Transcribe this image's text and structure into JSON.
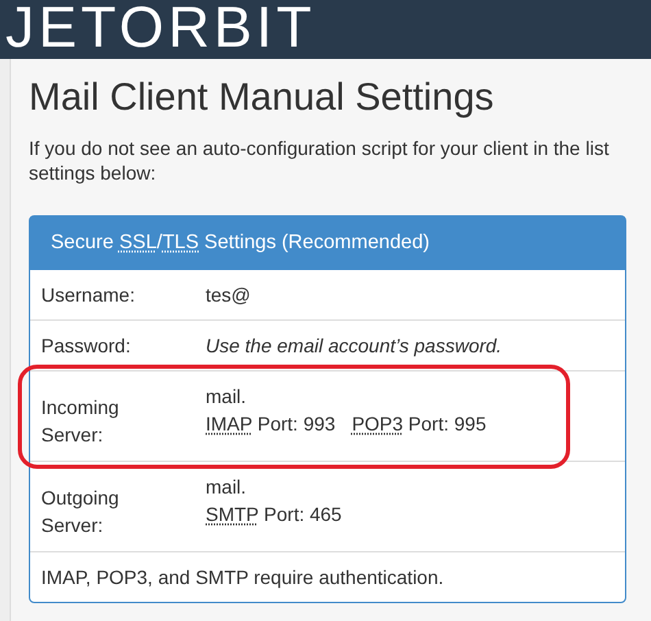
{
  "header": {
    "logo": "JETORBIT"
  },
  "page": {
    "title": "Mail Client Manual Settings",
    "intro_lines": [
      "If you do not see an auto-configuration script for your client in the list",
      "settings below:"
    ]
  },
  "panel": {
    "title": [
      {
        "text": "Secure "
      },
      {
        "text": "SSL",
        "abbr": true
      },
      {
        "text": "/"
      },
      {
        "text": "TLS",
        "abbr": true
      },
      {
        "text": " Settings (Recommended)"
      }
    ],
    "rows": [
      {
        "kind": "text",
        "label": "Username:",
        "value": "tes@",
        "highlighted": false
      },
      {
        "kind": "note",
        "label": "Password:",
        "value": "Use the email account’s password.",
        "highlighted": false
      },
      {
        "kind": "server",
        "label": "Incoming Server:",
        "host": "mail.",
        "ports": [
          {
            "protocol": "IMAP",
            "label": "Port: 993"
          },
          {
            "protocol": "POP3",
            "label": "Port: 995"
          }
        ],
        "highlighted": true
      },
      {
        "kind": "server",
        "label": "Outgoing Server:",
        "host": "mail.",
        "ports": [
          {
            "protocol": "SMTP",
            "label": "Port: 465"
          }
        ],
        "highlighted": false
      }
    ],
    "footer": "IMAP, POP3, and SMTP require authentication."
  }
}
